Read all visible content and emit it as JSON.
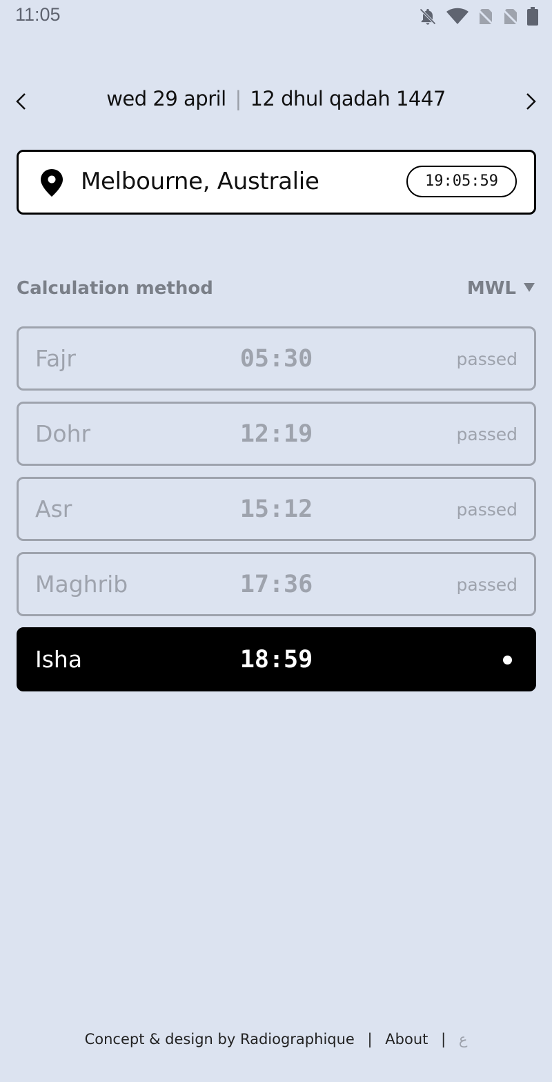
{
  "status_bar": {
    "time": "11:05",
    "icons": [
      "bell-off-icon",
      "wifi-icon",
      "no-sim-icon",
      "no-sim-icon",
      "battery-icon"
    ]
  },
  "date_nav": {
    "gregorian": "wed 29 april",
    "separator": "|",
    "hijri": "12 dhul qadah 1447",
    "prev_icon": "chevron-left-icon",
    "next_icon": "chevron-right-icon"
  },
  "location": {
    "icon": "map-pin-icon",
    "name": "Melbourne, Australie",
    "local_time": "19:05:59"
  },
  "calculation": {
    "label": "Calculation method",
    "value": "MWL",
    "icon": "dropdown-triangle-icon"
  },
  "prayers": [
    {
      "name": "Fajr",
      "time": "05:30",
      "status": "passed"
    },
    {
      "name": "Dohr",
      "time": "12:19",
      "status": "passed"
    },
    {
      "name": "Asr",
      "time": "15:12",
      "status": "passed"
    },
    {
      "name": "Maghrib",
      "time": "17:36",
      "status": "passed"
    },
    {
      "name": "Isha",
      "time": "18:59",
      "status": ""
    }
  ],
  "footer": {
    "credit": "Concept & design by Radiographique",
    "separator": "|",
    "about": "About",
    "arabic": "ع"
  },
  "colors": {
    "background": "#dce3f0",
    "passed": "#9ea3ad",
    "active_bg": "#000000",
    "active_fg": "#ffffff"
  }
}
